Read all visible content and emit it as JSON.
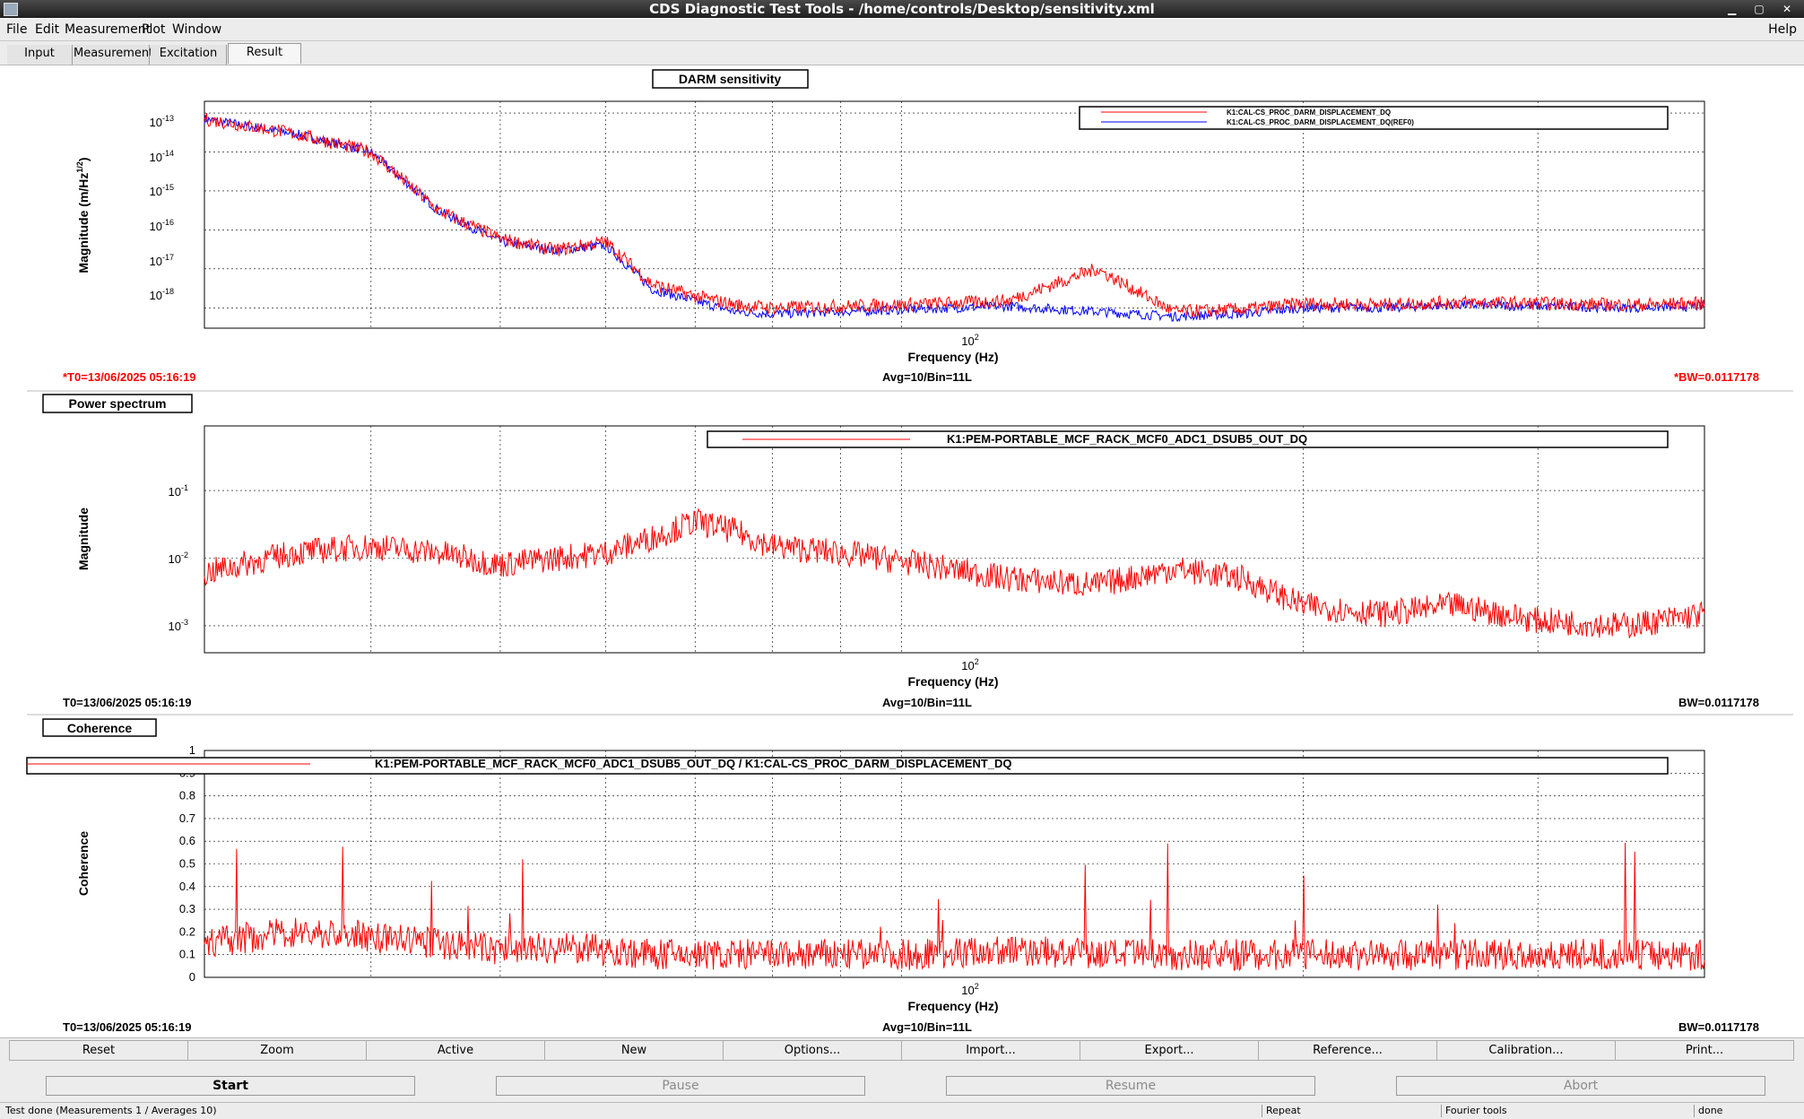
{
  "window": {
    "title": "CDS Diagnostic Test Tools - /home/controls/Desktop/sensitivity.xml",
    "controls": "▁ ▢ ✕"
  },
  "menu": {
    "file": "File",
    "edit": "Edit",
    "measurement": "Measurement",
    "plot": "Plot",
    "window": "Window",
    "help": "Help"
  },
  "tabs": {
    "input": "Input",
    "measurement": "Measurement",
    "excitation": "Excitation",
    "result": "Result"
  },
  "panels": [
    {
      "title": "DARM sensitivity",
      "xlabel": "Frequency (Hz)",
      "ylabel": "Magnitude (m/Hz",
      "ylabel_sup": "1/2",
      "ylabel_end": ")",
      "xtick": "10",
      "xtick_exp": "2",
      "ytick_base": "10",
      "ytick_exps": [
        "-13",
        "-14",
        "-15",
        "-16",
        "-17",
        "-18"
      ],
      "legend": [
        "K1:CAL-CS_PROC_DARM_DISPLACEMENT_DQ",
        "K1:CAL-CS_PROC_DARM_DISPLACEMENT_DQ(REF0)"
      ],
      "t0": "*T0=13/06/2025 05:16:19",
      "avg": "Avg=10/Bin=11L",
      "bw": "*BW=0.0117178"
    },
    {
      "title": "Power spectrum",
      "xlabel": "Frequency (Hz)",
      "ylabel": "Magnitude",
      "xtick": "10",
      "xtick_exp": "2",
      "ytick_base": "10",
      "ytick_exps": [
        "-1",
        "-2",
        "-3"
      ],
      "legend": [
        "K1:PEM-PORTABLE_MCF_RACK_MCF0_ADC1_DSUB5_OUT_DQ"
      ],
      "t0": "T0=13/06/2025 05:16:19",
      "avg": "Avg=10/Bin=11L",
      "bw": "BW=0.0117178"
    },
    {
      "title": "Coherence",
      "xlabel": "Frequency (Hz)",
      "ylabel": "Coherence",
      "xtick": "10",
      "xtick_exp": "2",
      "yticks": [
        "1",
        "0.9",
        "0.8",
        "0.7",
        "0.6",
        "0.5",
        "0.4",
        "0.3",
        "0.2",
        "0.1",
        "0"
      ],
      "legend": [
        "K1:PEM-PORTABLE_MCF_RACK_MCF0_ADC1_DSUB5_OUT_DQ / K1:CAL-CS_PROC_DARM_DISPLACEMENT_DQ"
      ],
      "t0": "T0=13/06/2025 05:16:19",
      "avg": "Avg=10/Bin=11L",
      "bw": "BW=0.0117178"
    }
  ],
  "colors": {
    "trace_main": "#ff0000",
    "trace_ref": "#0000ff",
    "t0_highlight": "#ff0000"
  },
  "toolbar": [
    "Reset",
    "Zoom",
    "Active",
    "New",
    "Options...",
    "Import...",
    "Export...",
    "Reference...",
    "Calibration...",
    "Print..."
  ],
  "controls": {
    "start": "Start",
    "pause": "Pause",
    "resume": "Resume",
    "abort": "Abort"
  },
  "status": {
    "message": "Test done (Measurements 1 / Averages 10)",
    "repeat": "Repeat",
    "fourier": "Fourier tools",
    "state": "done"
  },
  "chart_data": [
    {
      "type": "line",
      "title": "DARM sensitivity",
      "xlabel": "Frequency (Hz)",
      "ylabel": "Magnitude (m/Hz^1/2)",
      "xscale": "log",
      "yscale": "log",
      "ylim": [
        3e-19,
        2e-13
      ],
      "x": [
        30,
        35,
        40,
        45,
        50,
        55,
        60,
        65,
        70,
        75,
        80,
        90,
        100,
        120,
        140,
        160,
        180,
        200,
        230,
        260,
        300,
        350,
        400
      ],
      "series": [
        {
          "name": "K1:CAL-CS_PROC_DARM_DISPLACEMENT_DQ",
          "values": [
            7e-14,
            3e-14,
            1e-14,
            3e-16,
            6e-17,
            3e-17,
            5e-17,
            4e-18,
            2e-18,
            1.2e-18,
            1e-18,
            1.1e-18,
            1.2e-18,
            1.5e-18,
            1e-17,
            8e-19,
            9e-19,
            1.3e-18,
            1.2e-18,
            1.4e-18,
            1.3e-18,
            1.2e-18,
            1.3e-18
          ]
        },
        {
          "name": "K1:CAL-CS_PROC_DARM_DISPLACEMENT_DQ(REF0)",
          "values": [
            7e-14,
            3e-14,
            1e-14,
            3e-16,
            5e-17,
            3e-17,
            4e-17,
            3e-18,
            1.5e-18,
            8e-19,
            7e-19,
            8e-19,
            9e-19,
            1.1e-18,
            8e-19,
            6e-19,
            7e-19,
            1e-18,
            1e-18,
            1.2e-18,
            1.1e-18,
            1e-18,
            1.1e-18
          ]
        }
      ],
      "legend": "top-right",
      "grid": true
    },
    {
      "type": "line",
      "title": "Power spectrum",
      "xlabel": "Frequency (Hz)",
      "ylabel": "Magnitude",
      "xscale": "log",
      "yscale": "log",
      "ylim": [
        0.0004,
        0.9
      ],
      "x": [
        30,
        35,
        40,
        45,
        50,
        55,
        60,
        65,
        70,
        75,
        80,
        90,
        100,
        120,
        140,
        160,
        180,
        200,
        230,
        260,
        300,
        350,
        400
      ],
      "series": [
        {
          "name": "K1:PEM-PORTABLE_MCF_RACK_MCF0_ADC1_DSUB5_OUT_DQ",
          "values": [
            0.006,
            0.012,
            0.015,
            0.012,
            0.008,
            0.01,
            0.012,
            0.02,
            0.035,
            0.025,
            0.015,
            0.012,
            0.009,
            0.005,
            0.004,
            0.007,
            0.005,
            0.002,
            0.0015,
            0.002,
            0.0012,
            0.001,
            0.0015
          ]
        }
      ],
      "legend": "top-right",
      "grid": true
    },
    {
      "type": "line",
      "title": "Coherence",
      "xlabel": "Frequency (Hz)",
      "ylabel": "Coherence",
      "xscale": "log",
      "ylim": [
        0,
        1
      ],
      "x": [
        30,
        35,
        40,
        45,
        50,
        55,
        60,
        65,
        70,
        75,
        80,
        90,
        100,
        120,
        140,
        160,
        180,
        200,
        230,
        260,
        300,
        350,
        400
      ],
      "series": [
        {
          "name": "K1:PEM-PORTABLE_MCF_RACK_MCF0_ADC1_DSUB5_OUT_DQ / K1:CAL-CS_PROC_DARM_DISPLACEMENT_DQ",
          "values": [
            0.15,
            0.2,
            0.18,
            0.15,
            0.12,
            0.13,
            0.12,
            0.1,
            0.1,
            0.1,
            0.1,
            0.1,
            0.1,
            0.12,
            0.1,
            0.1,
            0.1,
            0.1,
            0.1,
            0.1,
            0.1,
            0.1,
            0.1
          ]
        }
      ],
      "legend": "top-right",
      "grid": true
    }
  ]
}
